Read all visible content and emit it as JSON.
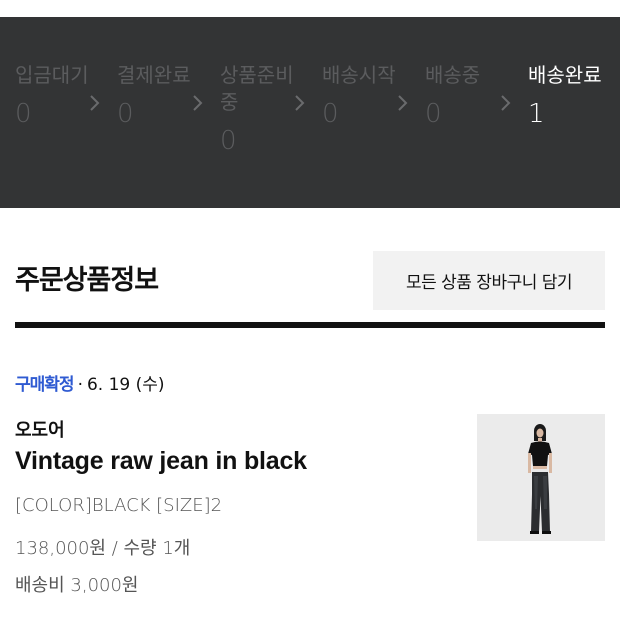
{
  "status_steps": [
    {
      "label": "입금대기",
      "count": "0"
    },
    {
      "label": "결제완료",
      "count": "0"
    },
    {
      "label": "상품준비중",
      "count": "0"
    },
    {
      "label": "배송시작",
      "count": "0"
    },
    {
      "label": "배송중",
      "count": "0"
    },
    {
      "label": "배송완료",
      "count": "1"
    }
  ],
  "active_step": "배송완료",
  "section": {
    "title": "주문상품정보",
    "cart_button_label": "모든 상품 장바구니 담기"
  },
  "order": {
    "status": "구매확정",
    "separator": "·",
    "date": "6. 19 (수)",
    "brand": "오도어",
    "product_name": "Vintage raw jean in black",
    "option": "[COLOR]BLACK [SIZE]2",
    "price": "138,000원 / 수량 1개",
    "shipping": "배송비 3,000원"
  },
  "colors": {
    "status_bg": "#333435",
    "inactive_text": "#5b5c5e",
    "active_text": "#ffffff",
    "confirm_blue": "#2f5bd2"
  }
}
